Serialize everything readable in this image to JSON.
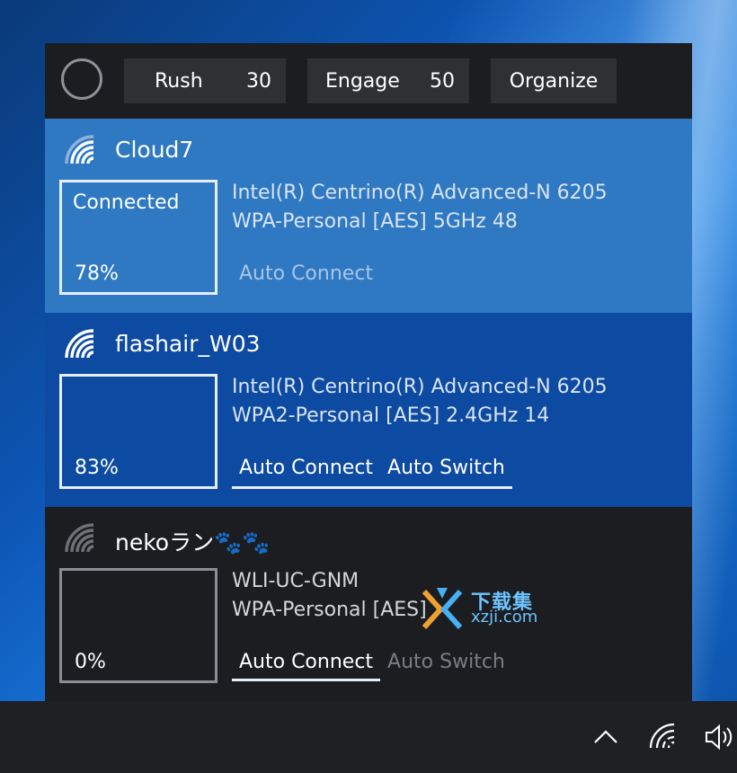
{
  "toolbar": {
    "rush_label": "Rush",
    "rush_value": "30",
    "engage_label": "Engage",
    "engage_value": "50",
    "organize_label": "Organize"
  },
  "networks": [
    {
      "ssid": "Cloud7",
      "state": "Connected",
      "signal": "78%",
      "adapter": "Intel(R) Centrino(R) Advanced-N 6205",
      "security": "WPA-Personal [AES] 5GHz 48",
      "auto_connect": "Auto Connect",
      "auto_switch": ""
    },
    {
      "ssid": "flashair_W03",
      "state": "",
      "signal": "83%",
      "adapter": "Intel(R) Centrino(R) Advanced-N 6205",
      "security": "WPA2-Personal [AES] 2.4GHz 14",
      "auto_connect": "Auto Connect",
      "auto_switch": "Auto Switch"
    },
    {
      "ssid": "nekoラン🐾🐾",
      "state": "",
      "signal": "0%",
      "adapter": "WLI-UC-GNM",
      "security": "WPA-Personal [AES]",
      "auto_connect": "Auto Connect",
      "auto_switch": "Auto Switch"
    }
  ],
  "watermark": {
    "title": "下载集",
    "site": "xzji.com"
  },
  "colors": {
    "toolbar_bg": "#1b1d21",
    "connected_bg": "#2f79c3",
    "selected_bg": "#0d4aa2",
    "dark_bg": "#1b1d21",
    "taskbar_bg": "#1e2024"
  },
  "icons": {
    "tray": [
      "chevron-up-icon",
      "network-icon",
      "volume-icon"
    ],
    "network": "wifi-signal-icon"
  }
}
